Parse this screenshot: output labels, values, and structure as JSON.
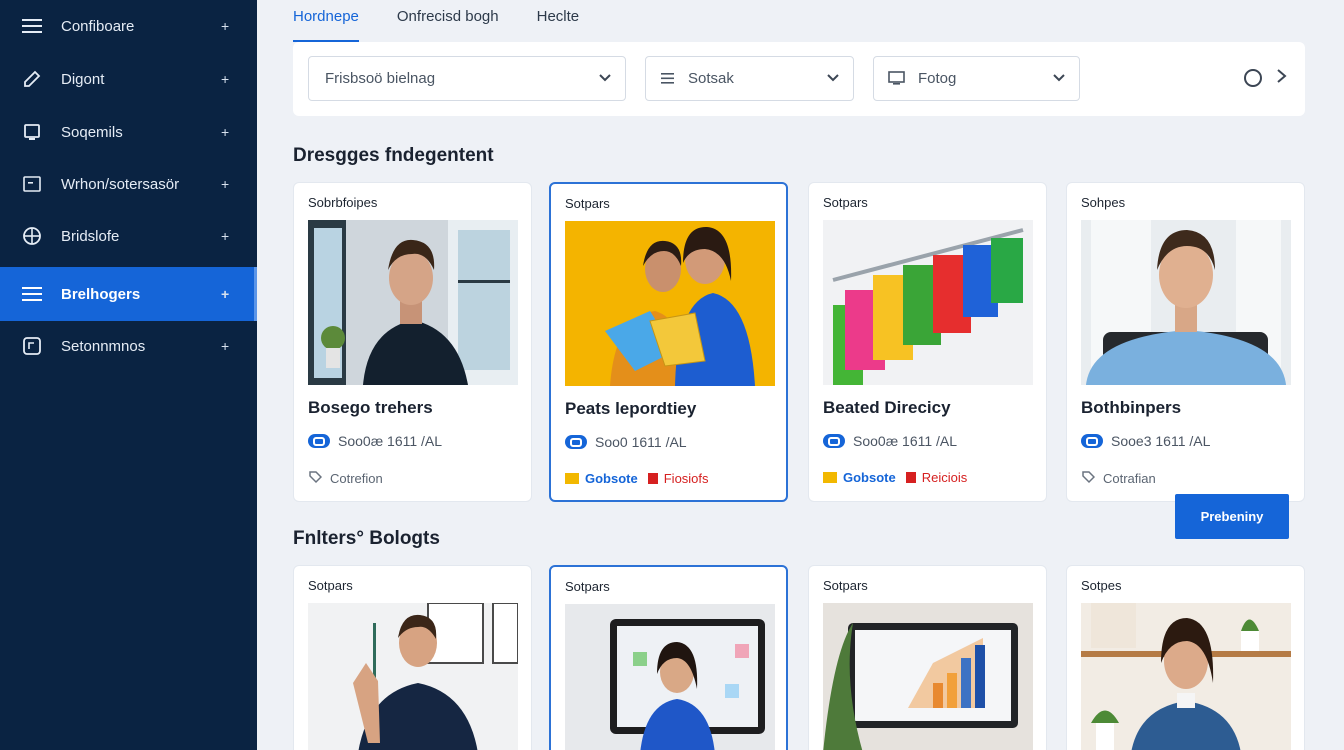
{
  "sidebar": {
    "items": [
      {
        "label": "Confiboare",
        "icon": "menu-icon"
      },
      {
        "label": "Digont",
        "icon": "pencil-icon"
      },
      {
        "label": "Soqemils",
        "icon": "device-icon"
      },
      {
        "label": "Wrhon/sotersasör",
        "icon": "document-icon"
      },
      {
        "label": "Bridslofe",
        "icon": "globe-icon"
      },
      {
        "label": "Brelhogers",
        "icon": "menu-icon",
        "active": true
      },
      {
        "label": "Setonnmnos",
        "icon": "note-icon"
      }
    ],
    "expand_symbol": "+"
  },
  "tabs": [
    "Hordnepe",
    "Onfrecisd bogh",
    "Heclte"
  ],
  "filters": {
    "first": "Frisbsoö bielnag",
    "second": "Sotsak",
    "third": "Fotog"
  },
  "sections": {
    "first_title": "Dresgges fndegentent",
    "second_title": "Fnlters° Bologts"
  },
  "cards_row1": [
    {
      "category": "Sobrbfoipes",
      "title": "Bosego trehers",
      "price": "Soo0æ 1611 /AL",
      "foot_a": "Cotrefion"
    },
    {
      "category": "Sotpars",
      "title": "Peats lepordtiey",
      "price": "Soo0 1611 /AL",
      "tag_a": "Gobsote",
      "tag_b": "Fiosiofs"
    },
    {
      "category": "Sotpars",
      "title": "Beated Direcicy",
      "price": "Soo0æ 1611 /AL",
      "tag_a": "Gobsote",
      "tag_b": "Reiciois"
    },
    {
      "category": "Sohpes",
      "title": "Bothbinpers",
      "price": "Sooe3 1611 /AL",
      "foot_a": "Cotrafian"
    }
  ],
  "cards_row2": [
    {
      "category": "Sotpars"
    },
    {
      "category": "Sotpars"
    },
    {
      "category": "Sotpars"
    },
    {
      "category": "Sotpes"
    }
  ],
  "cta_label": "Prebeniny",
  "colors": {
    "sidebar": "#0a2342",
    "accent": "#1565d8",
    "danger": "#d62020",
    "warning": "#f2b800"
  }
}
